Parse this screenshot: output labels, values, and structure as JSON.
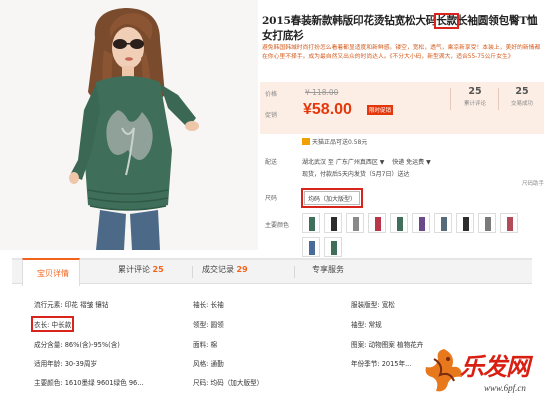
{
  "product": {
    "title_before": "2015春装新款韩版印花烫钻宽松大码",
    "title_highlight": "长款",
    "title_after": "长袖圆领包臀T恤女打底衫",
    "subtitle": "避免韩国韩城时尚打扮怎么看着都显适度和新鲜感。镂空，宽松，透气，乘凉新享受！本装上，美好的新情都在你心里不择手。成为最自然又出众的时尚达人。《不分大小码，新型满大，适合55-75公斤女生》"
  },
  "price": {
    "label": "价格",
    "original": "¥ 118.00",
    "promo_label": "促销",
    "current": "¥58.00",
    "promo_tag": "限时促销",
    "stats": [
      {
        "value": "25",
        "label": "累计评论"
      },
      {
        "value": "25",
        "label": "交易成功"
      }
    ]
  },
  "tmall": "天猫正品可送0.58元",
  "shipping": {
    "label": "配送",
    "origin": "湖北武汉 至 广东广州真西区 ▼",
    "method": "快递 免运费 ▼",
    "sub": "现货，付款后5天内发货（5月7日）送达"
  },
  "size": {
    "label": "尺码",
    "value": "均码（加大版型）",
    "chart_link": "尺码助手"
  },
  "color_label": "主要颜色",
  "tabs": [
    {
      "label": "宝贝详情",
      "count": ""
    },
    {
      "label": "累计评论",
      "count": "25"
    },
    {
      "label": "成交记录",
      "count": "29"
    },
    {
      "label": "专享服务",
      "count": ""
    }
  ],
  "attributes": {
    "col1": [
      "流行元素: 印花 褶皱 镶钻",
      "衣长: 中长款",
      "成分含量: 86%(含)-95%(含)",
      "适用年龄: 30-39周岁",
      "主要颜色: 1610墨绿 9601绿色 96..."
    ],
    "col2": [
      "袖长: 长袖",
      "领型: 圆领",
      "面料: 棉",
      "风格: 通勤",
      "尺码: 均码（加大版型）"
    ],
    "col3": [
      "服装版型: 宽松",
      "袖型: 常规",
      "图案: 动物图案 植物花卉",
      "年份季节: 2015年..."
    ]
  },
  "watermark": {
    "text": "乐发网",
    "url": "www.6pf.cn"
  },
  "colors": {
    "accent": "#e4380c",
    "highlight_box": "#d8241c",
    "tab_active": "#f2641e",
    "price_bg": "#fdeee5",
    "garment": "#3f6e5a"
  }
}
